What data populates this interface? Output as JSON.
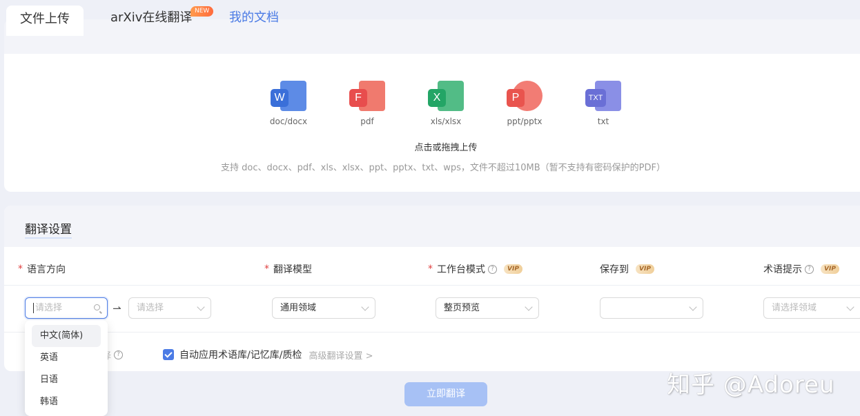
{
  "tabs": {
    "upload": "文件上传",
    "arxiv": "arXiv在线翻译",
    "arxiv_badge": "NEW",
    "docs": "我的文档"
  },
  "filetypes": [
    {
      "caption": "doc/docx",
      "letter": "W",
      "icon": "word-icon",
      "color": "#3a6fd9",
      "back": "#5d8be6"
    },
    {
      "caption": "pdf",
      "letter": "F",
      "icon": "pdf-icon",
      "color": "#e84d4d",
      "back": "#f07a6e"
    },
    {
      "caption": "xls/xlsx",
      "letter": "X",
      "icon": "excel-icon",
      "color": "#23a566",
      "back": "#52bc86"
    },
    {
      "caption": "ppt/pptx",
      "letter": "P",
      "icon": "powerpoint-icon",
      "color": "#e9544e",
      "back": "#f27c74"
    },
    {
      "caption": "txt",
      "letter": "TXT",
      "icon": "txt-icon",
      "color": "#6a6fd6",
      "back": "#8a8fe6"
    }
  ],
  "upload": {
    "hint": "点击或拖拽上传",
    "support": "支持 doc、docx、pdf、xls、xlsx、ppt、pptx、txt、wps，文件不超过10MB（暂不支持有密码保护的PDF）"
  },
  "settings": {
    "title": "翻译设置",
    "labels": {
      "language": "语言方向",
      "model": "翻译模型",
      "workbench": "工作台模式",
      "save_to": "保存到",
      "term_hint": "术语提示"
    },
    "vip_badge": "VIP",
    "source_lang": {
      "placeholder": "请选择"
    },
    "target_lang": {
      "placeholder": "请选择"
    },
    "model_value": "通用领域",
    "workbench_value": "整页预览",
    "save_to_value": "",
    "term_hint_placeholder": "请选择领域",
    "auto_apply_label": "自动应用术语库/记忆库/质检",
    "advanced_link": "高级翻译设置 >",
    "obscured_label": "译"
  },
  "dropdown_options": [
    "中文(简体)",
    "英语",
    "日语",
    "韩语"
  ],
  "translate_button": "立即翻译",
  "watermark": "知乎 @Adoreu"
}
